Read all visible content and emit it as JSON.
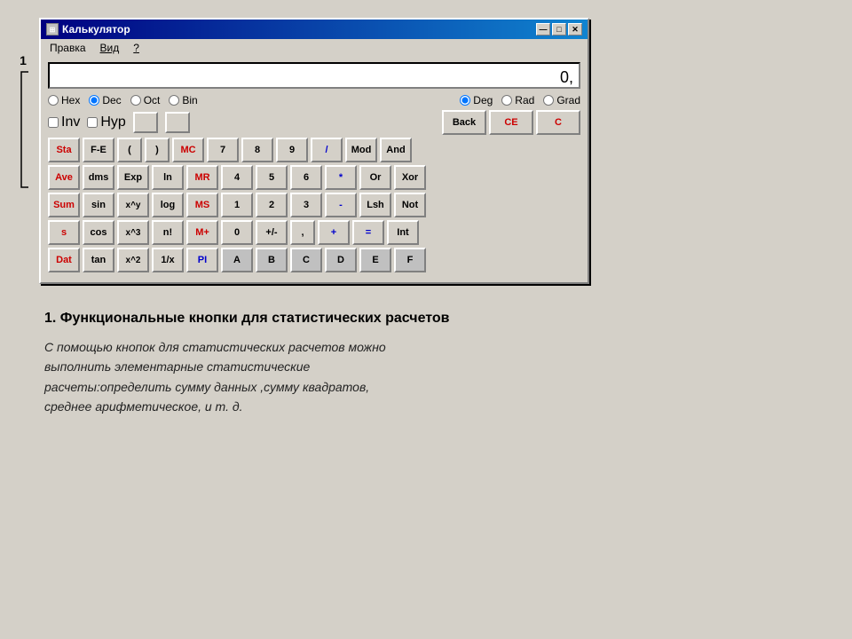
{
  "window": {
    "title": "Калькулятор",
    "menu": [
      "Правка",
      "Вид",
      "?"
    ],
    "title_btn_min": "—",
    "title_btn_max": "□",
    "title_btn_close": "✕"
  },
  "display": {
    "value": "0,"
  },
  "radio_number": {
    "options": [
      "Hex",
      "Dec",
      "Oct",
      "Bin"
    ],
    "selected": "Dec"
  },
  "radio_angle": {
    "options": [
      "Deg",
      "Rad",
      "Grad"
    ],
    "selected": "Deg"
  },
  "checkboxes": {
    "inv": "Inv",
    "hyp": "Hyp"
  },
  "buttons": {
    "back": "Back",
    "ce": "CE",
    "c": "C",
    "row1": [
      "Sta",
      "F-E",
      "(",
      ")",
      "MC",
      "7",
      "8",
      "9",
      "/",
      "Mod",
      "And"
    ],
    "row2": [
      "Ave",
      "dms",
      "Exp",
      "ln",
      "MR",
      "4",
      "5",
      "6",
      "*",
      "Or",
      "Xor"
    ],
    "row3": [
      "Sum",
      "sin",
      "x^y",
      "log",
      "MS",
      "1",
      "2",
      "3",
      "-",
      "Lsh",
      "Not"
    ],
    "row4": [
      "s",
      "cos",
      "x^3",
      "n!",
      "M+",
      "0",
      "+/-",
      ",",
      "+",
      "=",
      "Int"
    ],
    "row5": [
      "Dat",
      "tan",
      "x^2",
      "1/x",
      "PI",
      "A",
      "B",
      "C",
      "D",
      "E",
      "F"
    ]
  },
  "label_1": "1",
  "section": {
    "title": "1. Функциональные кнопки для статистических расчетов",
    "text": "С помощью кнопок для статистических расчетов можно выполнить элементарные статистические расчеты:определить сумму данных ,сумму квадратов, среднее арифметическое, и т. д."
  }
}
